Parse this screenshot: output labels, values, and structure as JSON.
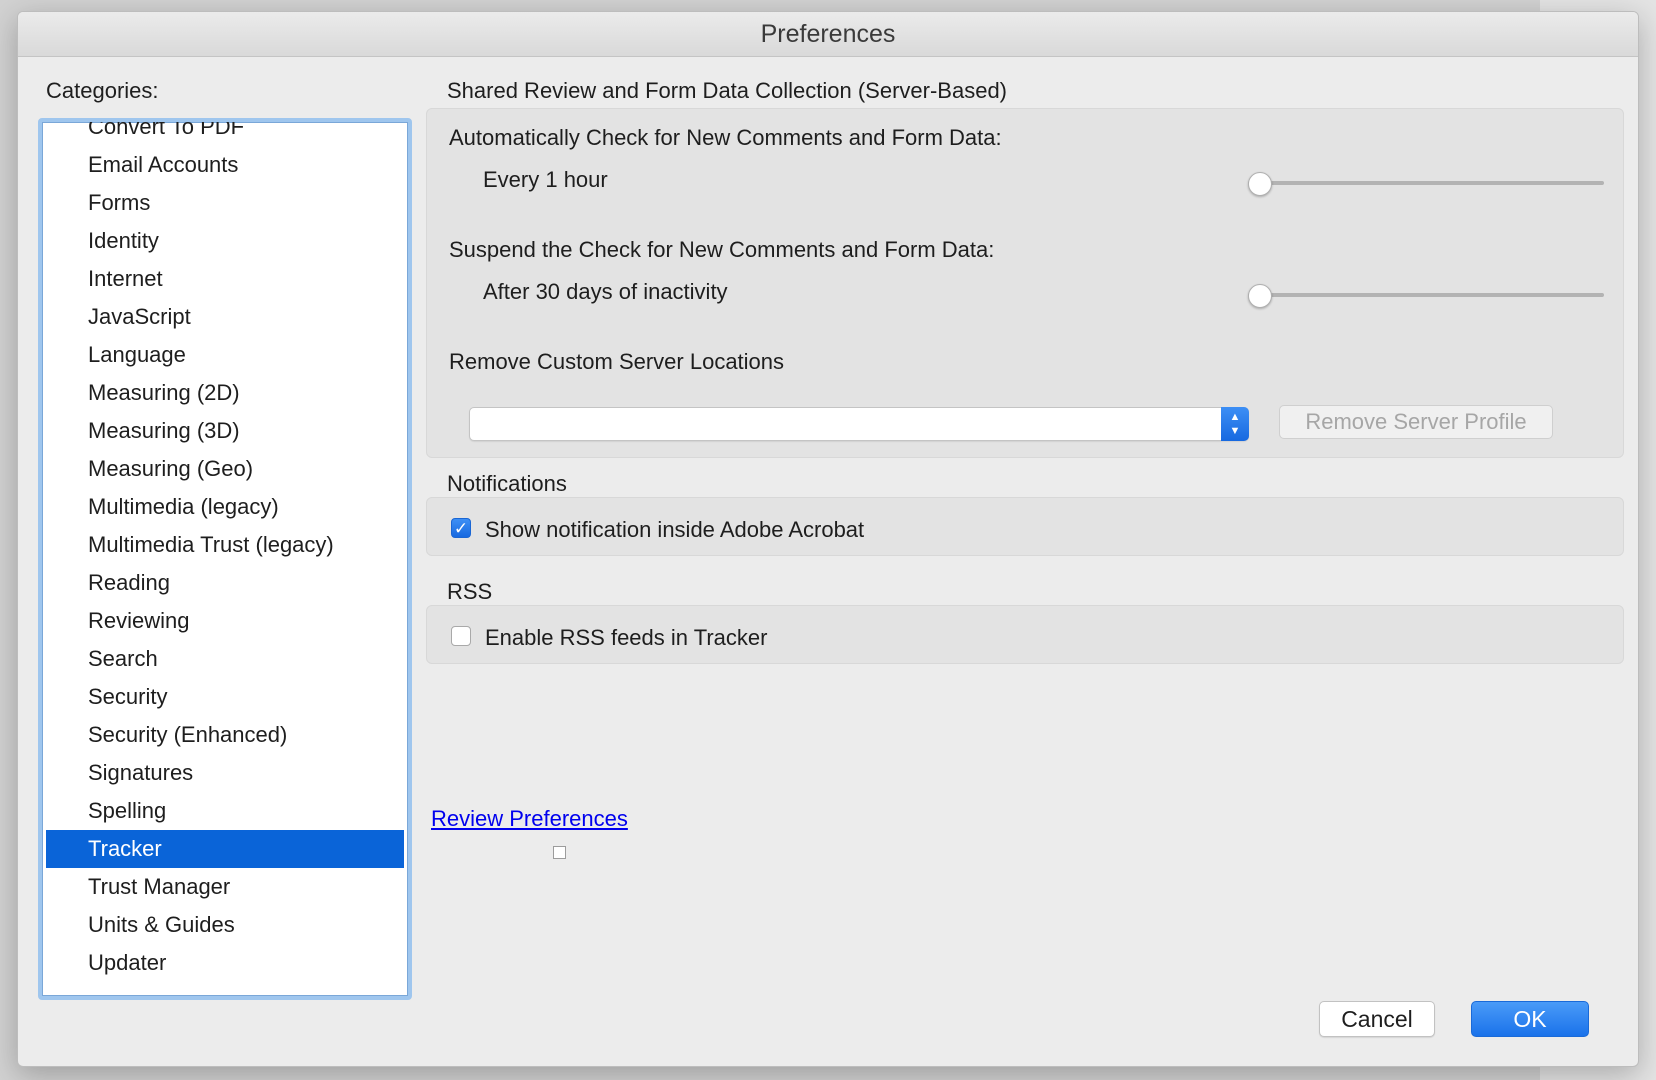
{
  "window": {
    "title": "Preferences"
  },
  "categories": {
    "label": "Categories:",
    "items": [
      "Convert To PDF",
      "Email Accounts",
      "Forms",
      "Identity",
      "Internet",
      "JavaScript",
      "Language",
      "Measuring (2D)",
      "Measuring (3D)",
      "Measuring (Geo)",
      "Multimedia (legacy)",
      "Multimedia Trust (legacy)",
      "Reading",
      "Reviewing",
      "Search",
      "Security",
      "Security (Enhanced)",
      "Signatures",
      "Spelling",
      "Tracker",
      "Trust Manager",
      "Units & Guides",
      "Updater"
    ],
    "selected": "Tracker"
  },
  "shared_review": {
    "heading": "Shared Review and Form Data Collection (Server-Based)",
    "auto_check_label": "Automatically Check for New Comments and Form Data:",
    "auto_check_value": "Every 1 hour",
    "auto_check_slider_fraction": 0,
    "suspend_label": "Suspend the Check for New Comments and Form Data:",
    "suspend_value": "After 30 days of inactivity",
    "suspend_slider_fraction": 0,
    "remove_locations_label": "Remove Custom Server Locations",
    "server_select_value": "",
    "remove_profile_button": "Remove Server Profile"
  },
  "notifications": {
    "heading": "Notifications",
    "show_notification_label": "Show notification inside Adobe Acrobat",
    "show_notification_checked": true
  },
  "rss": {
    "heading": "RSS",
    "enable_rss_label": "Enable RSS feeds in Tracker",
    "enable_rss_checked": false
  },
  "review_link": "Review Preferences",
  "buttons": {
    "cancel": "Cancel",
    "ok": "OK"
  },
  "colors": {
    "selection": "#0a64d8",
    "accent": "#1a72ea",
    "link": "#0000ee"
  }
}
